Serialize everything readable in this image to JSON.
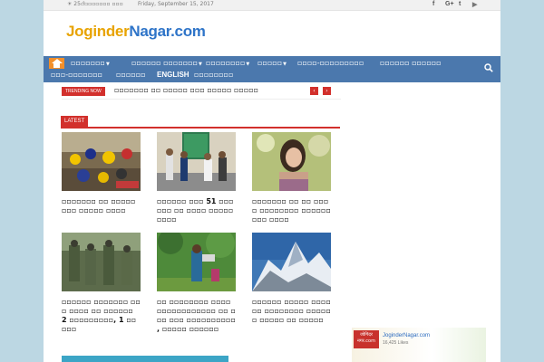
{
  "topbar": {
    "weather": "☀ 25 °",
    "city": "▫▫▫▫▫▫▫▫ ▫▫▫",
    "date": "Friday, September 15, 2017",
    "social": [
      "f",
      "G+",
      "t",
      "▶"
    ]
  },
  "logo": {
    "part1": "Joginder",
    "part2": "Nagar.com"
  },
  "nav": {
    "items": [
      {
        "label": "▫▫▫▫▫▫▫",
        "caret": "▼"
      },
      {
        "label": "▫▫▫▫▫▫ ▫▫▫▫▫▫▫",
        "caret": "▼"
      },
      {
        "label": "▫▫▫▫▫▫▫▫",
        "caret": "▼"
      },
      {
        "label": "▫▫▫▫▫",
        "caret": "▼"
      },
      {
        "label": "▫▫▫▫-▫▫▫▫▫▫▫▫▫",
        "caret": ""
      },
      {
        "label": "▫▫▫▫▫▫ ▫▫▫▫▫▫",
        "caret": ""
      },
      {
        "label": "▫▫▫-▫▫▫▫▫▫▫",
        "caret": ""
      },
      {
        "label": "▫▫▫▫▫▫",
        "caret": ""
      },
      {
        "label": "ENGLISH",
        "caret": ""
      },
      {
        "label": "▫▫▫▫▫▫▫▫",
        "caret": ""
      }
    ]
  },
  "trending": {
    "badge": "TRENDING NOW",
    "headline": "▫▫▫▫▫▫▫ ▫▫ ▫▫▫▫▫ ▫▫▫ ▫▫▫▫▫ ▫▫▫▫▫",
    "prev": "‹",
    "next": "›"
  },
  "latest": {
    "label": "LATEST",
    "cards": [
      {
        "title": "▫▫▫▫▫▫▫ ▫▫ ▫▫▫▫▫ ▫▫▫ ▫▫▫▫▫ ▫▫▫▫"
      },
      {
        "title": "▫▫▫▫▫▫ ▫▫▫ 51 ▫▫▫▫▫▫ ▫▫ ▫▫▫▫ ▫▫▫▫▫▫▫▫▫"
      },
      {
        "title": "▫▫▫▫▫▫▫ ▫▫ ▫▫ ▫▫▫▫ ▫▫▫▫▫▫▫▫ ▫▫▫▫▫▫ ▫▫▫ ▫▫▫▫"
      },
      {
        "title": "▫▫▫▫▫▫ ▫▫▫▫▫▫▫ ▫▫▫ ▫▫▫▫ ▫▫ ▫▫▫▫▫▫ 2 ▫▫▫▫▫▫▫▫▫, 1 ▫▫▫▫▫"
      },
      {
        "title": "▫▫ ▫▫▫▫▫▫▫▫ ▫▫▫▫ ▫▫▫▫▫▫▫▫▫▫▫▫ ▫▫ ▫▫▫ ▫▫▫ ▫▫▫▫▫▫▫▫▫▫ , ▫▫▫▫▫ ▫▫▫▫▫▫"
      },
      {
        "title": "▫▫▫▫▫▫ ▫▫▫▫▫ ▫▫▫▫▫▫ ▫▫▫▫▫▫▫▫ ▫▫▫▫▫▫ ▫▫▫▫▫ ▫▫ ▫▫▫▫▫"
      }
    ]
  },
  "ad": {
    "box": "जोगिंदर नगर.com",
    "url": "JoginderNagar.com",
    "stat": "16,425 Likes"
  },
  "colors": {
    "nav": "#4b78ad",
    "accent": "#d2302c",
    "home": "#f28f2a",
    "background": "#bcd7e3"
  }
}
